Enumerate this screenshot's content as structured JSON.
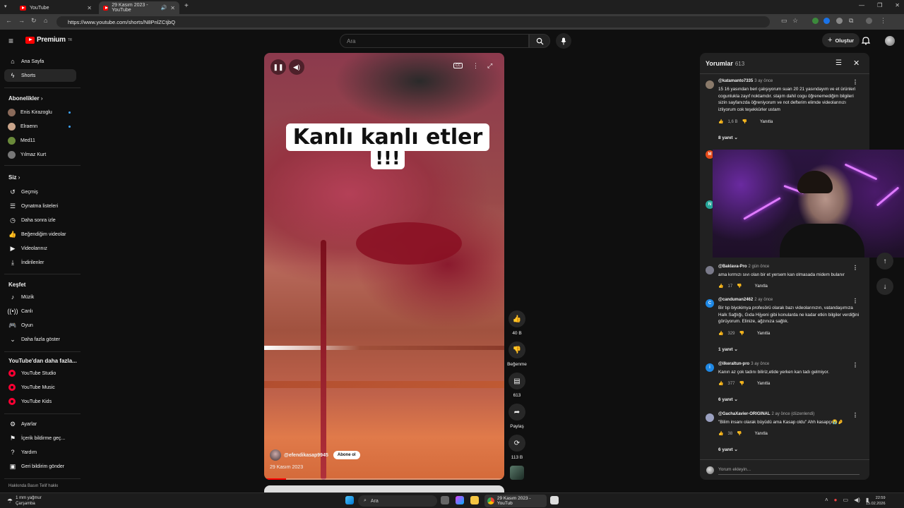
{
  "browser": {
    "tabs": [
      {
        "title": "YouTube",
        "active": false
      },
      {
        "title": "29 Kasım 2023 - YouTube",
        "active": true
      }
    ],
    "url": "https://www.youtube.com/shorts/N8PnlZCtjbQ"
  },
  "header": {
    "logo": "Premium",
    "logo_sup": "TR",
    "search_placeholder": "Ara",
    "create_label": "Oluştur"
  },
  "sidebar": {
    "main": [
      {
        "label": "Ana Sayfa",
        "icon": "home-icon"
      },
      {
        "label": "Shorts",
        "icon": "shorts-icon",
        "active": true
      }
    ],
    "subs_title": "Abonelikler",
    "subs": [
      {
        "label": "Enis Kirazoglu",
        "new": true,
        "color": "#8a6a5a"
      },
      {
        "label": "Elraenn",
        "new": true,
        "color": "#c9a48a"
      },
      {
        "label": "Med11",
        "new": false,
        "color": "#6a8a3a"
      },
      {
        "label": "Yılmaz Kurt",
        "new": false,
        "color": "#777777"
      }
    ],
    "you_title": "Siz",
    "you": [
      {
        "label": "Geçmiş",
        "icon": "history-icon"
      },
      {
        "label": "Oynatma listeleri",
        "icon": "playlist-icon"
      },
      {
        "label": "Daha sonra izle",
        "icon": "clock-icon"
      },
      {
        "label": "Beğendiğim videolar",
        "icon": "thumb-up-icon"
      },
      {
        "label": "Videolarınız",
        "icon": "video-icon"
      },
      {
        "label": "İndirilenler",
        "icon": "download-icon"
      }
    ],
    "explore_title": "Keşfet",
    "explore": [
      {
        "label": "Müzik",
        "icon": "music-icon"
      },
      {
        "label": "Canlı",
        "icon": "live-icon"
      },
      {
        "label": "Oyun",
        "icon": "gamepad-icon"
      },
      {
        "label": "Daha fazla göster",
        "icon": "chevron-down-icon"
      }
    ],
    "more_title": "YouTube'dan daha fazla...",
    "more": [
      {
        "label": "YouTube Studio"
      },
      {
        "label": "YouTube Music"
      },
      {
        "label": "YouTube Kids"
      }
    ],
    "settings": [
      {
        "label": "Ayarlar",
        "icon": "gear-icon"
      },
      {
        "label": "İçerik bildirme geç...",
        "icon": "flag-icon"
      },
      {
        "label": "Yardım",
        "icon": "help-icon"
      },
      {
        "label": "Geri bildirim gönder",
        "icon": "feedback-icon"
      }
    ],
    "footer": "Hakkında   Basın   Telif hakkı"
  },
  "video": {
    "caption_line1": "Kanlı kanlı etler",
    "caption_line2": "!!!",
    "channel": "@efendikasap9945",
    "subscribe_label": "Abone ol",
    "date": "29 Kasım 2023",
    "progress": 0.09
  },
  "actions": {
    "likes": "40 B",
    "dislike": "Beğenme",
    "comments": "613",
    "share": "Paylaş",
    "remix": "113 B"
  },
  "comments_panel": {
    "title": "Yorumlar",
    "count": "613",
    "input_placeholder": "Yorum ekleyin...",
    "items": [
      {
        "author": "@katamanto7335",
        "time": "3 ay önce",
        "text": "15 16 yasından beri çalışıyorum suan 20 21 yasındayım ve et ürünleri cogunlukla zayıf noktamdır. stajım dahil cogu öğrenemediğim bilgileri sizin sayfanızda öğreniyorum ve not defterim elimde videolarınızı izliyorum cok teşekkürler ustam",
        "likes": "1,6 B",
        "reply": "Yanıtla",
        "replies": "8 yanıt",
        "color": "#8a7a6a"
      },
      {
        "author": "@Baklava-Pro",
        "time": "2 gün önce",
        "text": "ama kırmızı sıvı olan bir et yersem kan olmasada midem bulanır",
        "likes": "17",
        "reply": "Yanıtla",
        "replies": "",
        "color": "#7a7a8a"
      },
      {
        "author": "@canduman2462",
        "time": "2 ay önce",
        "text": "Bir tıp biyokimya profesörü olarak bazı videolarınızın, vatandaşımıza Halk Sağlığı, Gıda Hijyeni gibi konularda ne kadar etkin bilgiler verdiğini görüyorum. Elinize, ağzınıza sağlık.",
        "likes": "329",
        "reply": "Yanıtla",
        "replies": "1 yanıt",
        "color": "#1e88e5",
        "initial": "C"
      },
      {
        "author": "@ilkeraltun-pro",
        "time": "3 ay önce",
        "text": "Kanın az çok tadını biliriz,etide yerken kan tadı gelmiyor.",
        "likes": "377",
        "reply": "Yanıtla",
        "replies": "6 yanıt",
        "color": "#1e88e5",
        "initial": "i"
      },
      {
        "author": "@GachaXavier-ORIGINAL",
        "time": "2 ay önce (düzenlendi)",
        "text": "\"Bilim insanı olarak büyüdü ama Kasap oldu\" Ahh kasapçı😭🤌",
        "likes": "38",
        "reply": "Yanıtla",
        "replies": "6 yanıt",
        "color": "#9aa0c0"
      }
    ],
    "hidden_avatars": [
      {
        "initial": "M",
        "color": "#e64a19"
      },
      {
        "initial": "N",
        "color": "#26a69a"
      }
    ]
  },
  "taskbar": {
    "weather_line1": "1 mm yağmur",
    "weather_line2": "Çarşamba",
    "search": "Ara",
    "chrome_title": "29 Kasım 2023 - YouTub",
    "time": "22:59",
    "date": "15.02.2026"
  }
}
